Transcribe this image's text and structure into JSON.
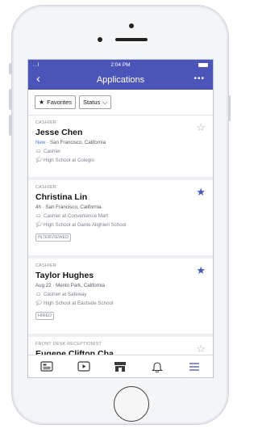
{
  "status_bar": {
    "signal": "..l",
    "time": "2:04 PM"
  },
  "header": {
    "back_glyph": "‹",
    "title": "Applications",
    "more_glyph": "•••"
  },
  "filters": [
    {
      "label": "Favorites",
      "icon": "star-filled-icon",
      "glyph": "★"
    },
    {
      "label": "Status",
      "icon": "chevron-down-icon",
      "glyph": "⌵"
    }
  ],
  "applications": [
    {
      "role": "CASHIER",
      "name": "Jesse Chen",
      "badge": "New",
      "meta": " · San Francisco, California",
      "job": "Cashier",
      "school": "High School at Colegio",
      "tag": "",
      "favorite": false
    },
    {
      "role": "CASHIER",
      "name": "Christina Lin",
      "badge": "",
      "meta": "4h · San Francisco, California",
      "job": "Cashier at Convenience Mart",
      "school": "High School at Dante Alighieri School",
      "tag": "INTERVIEWED",
      "favorite": true
    },
    {
      "role": "CASHIER",
      "name": "Taylor Hughes",
      "badge": "",
      "meta": "Aug 22 · Menlo Park, California",
      "job": "Cashier at Safeway",
      "school": "High School at Eastside School",
      "tag": "HIRED",
      "favorite": true
    },
    {
      "role": "FRONT DESK RECEPTIONIST",
      "name": "Eugene Clifton Cha",
      "badge": "",
      "meta": "",
      "job": "",
      "school": "",
      "tag": "",
      "favorite": false
    }
  ],
  "tabbar": [
    {
      "icon": "news-feed-icon",
      "active": false
    },
    {
      "icon": "video-icon",
      "active": false
    },
    {
      "icon": "marketplace-icon",
      "active": false
    },
    {
      "icon": "bell-icon",
      "active": false
    },
    {
      "icon": "menu-icon",
      "active": true
    }
  ],
  "colors": {
    "accent": "#4b55b8",
    "new_badge": "#4b7be5",
    "star_off": "#a7adb6"
  }
}
